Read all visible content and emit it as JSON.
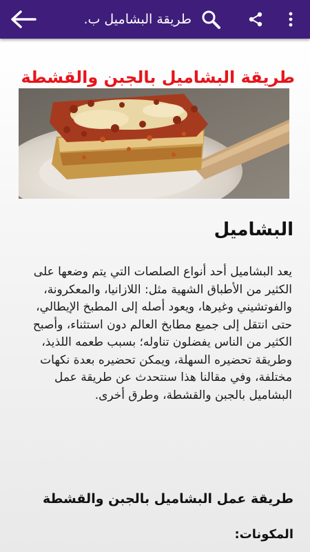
{
  "appbar": {
    "title": "طريقة البشاميل ب.",
    "back_icon": "arrow-left-icon",
    "search_icon": "search-icon",
    "share_icon": "share-icon",
    "more_icon": "more-vert-icon",
    "color": "#3f1d7a"
  },
  "article": {
    "title": "طريقة البشاميل بالجبن والقشطة",
    "title_color": "#e8141b",
    "section_heading": "البشاميل",
    "paragraph": "يعد البشاميل أحد أنواع الصلصات التي يتم وضعها على الكثير من الأطباق الشهية مثل: اللازانيا، والمعكرونة، والفوتشيني وغيرها، ويعود أصله إلى المطبخ الإيطالي، حتى انتقل إلى جميع مطابخ العالم دون استثناء، وأصبح الكثير من الناس يفضلون تناوله؛ بسبب طعمه اللذيذ، وطريقة تحضيره السهلة، ويمكن تحضيره بعدة نكهات مختلفة، وفي مقالنا هذا سنتحدث عن طريقة عمل البشاميل بالجبن والقشطة، وطرق أخرى.",
    "subheading": "طريقة عمل البشاميل بالجبن والقشطة",
    "ingredients_label": "المكونات:"
  }
}
